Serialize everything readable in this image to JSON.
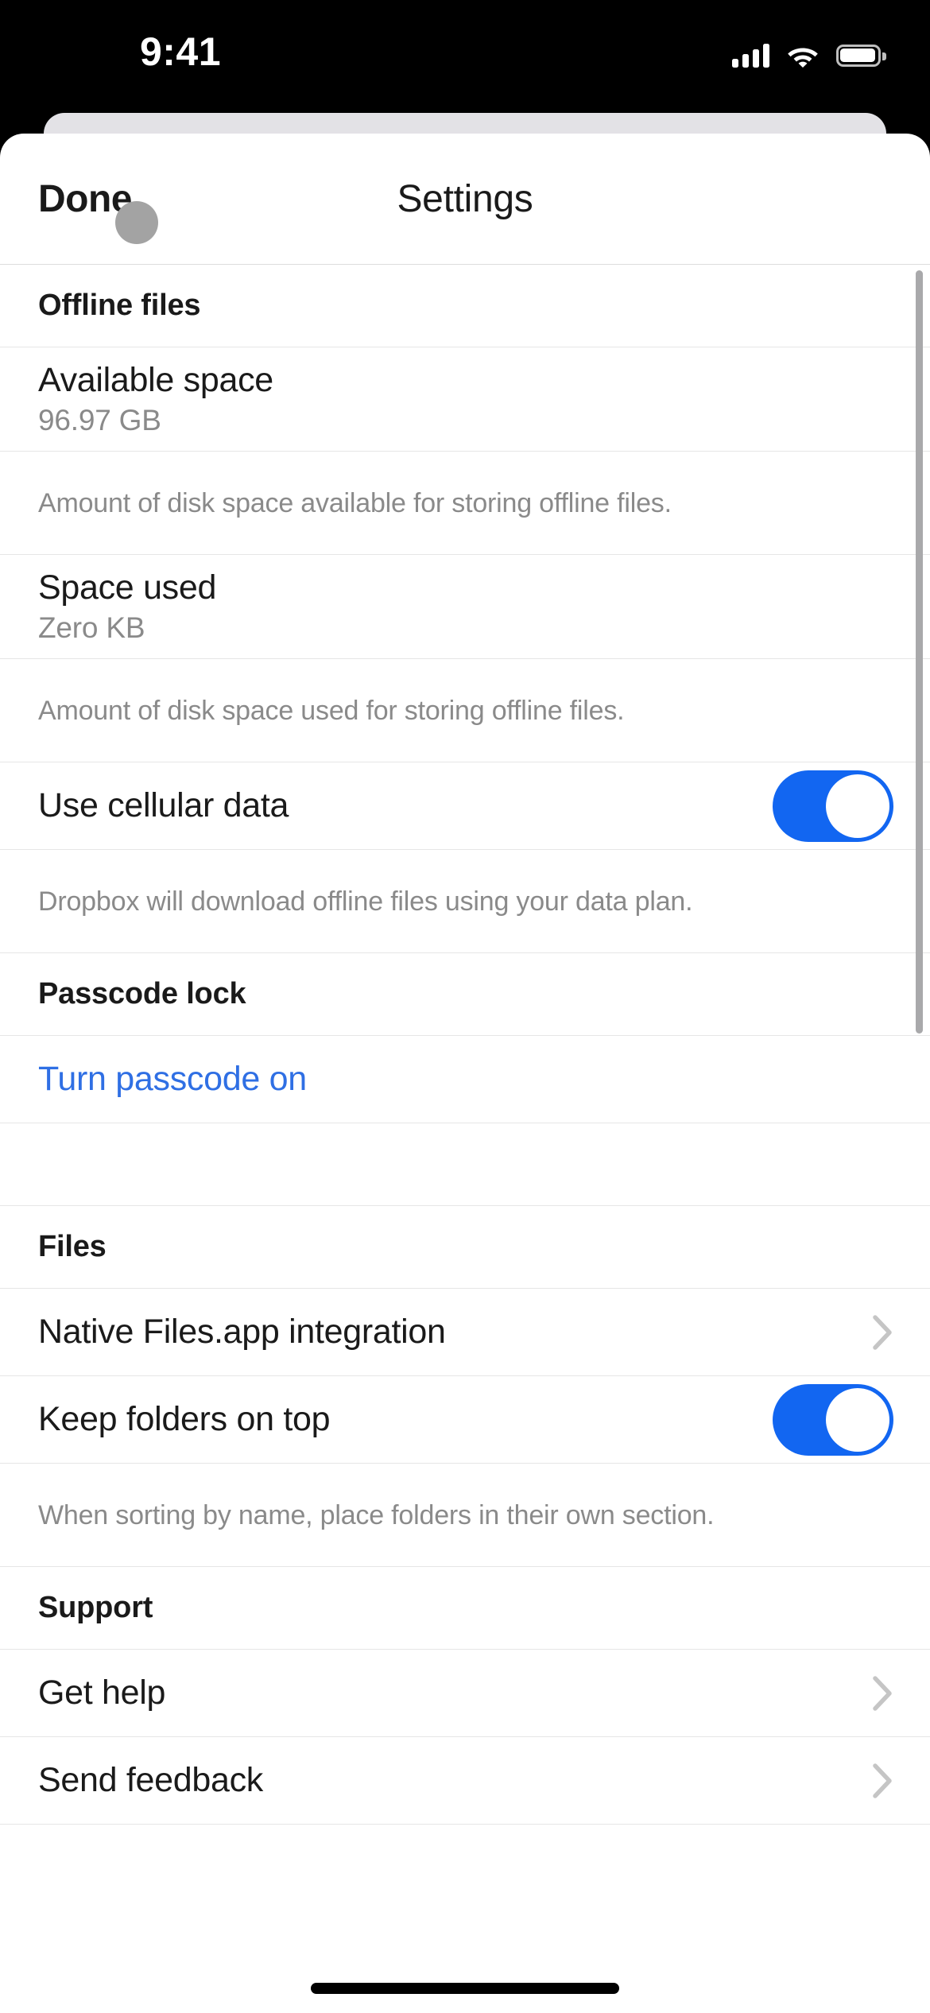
{
  "status_bar": {
    "time": "9:41",
    "icons": [
      "cellular-signal-icon",
      "wifi-icon",
      "battery-icon"
    ],
    "battery_level": 100,
    "cellular_bars": 4
  },
  "nav_bar": {
    "done_label": "Done",
    "title": "Settings"
  },
  "colors": {
    "accent_blue": "#1266f1",
    "link_blue": "#2f6fe4",
    "separator": "#e6e6e6",
    "secondary_text": "#8a8a8a",
    "primary_text": "#1a1a1a",
    "sheet_back": "#e3e2e6",
    "scrollbar": "#a9a9ab",
    "cursor": "#a3a3a3"
  },
  "sections": {
    "offline_files": {
      "header": "Offline files",
      "available_space": {
        "title": "Available space",
        "value": "96.97 GB",
        "description": "Amount of disk space available for storing offline files."
      },
      "space_used": {
        "title": "Space used",
        "value": "Zero KB",
        "description": "Amount of disk space used for storing offline files."
      },
      "use_cellular_data": {
        "title": "Use cellular data",
        "toggle_state": "on",
        "description": "Dropbox will download offline files using your data plan."
      }
    },
    "passcode_lock": {
      "header": "Passcode lock",
      "turn_passcode_on": "Turn passcode on"
    },
    "files": {
      "header": "Files",
      "native_files_integration": {
        "title": "Native Files.app integration",
        "accessory": "chevron-right-icon"
      },
      "keep_folders_on_top": {
        "title": "Keep folders on top",
        "toggle_state": "on",
        "description": "When sorting by name, place folders in their own section."
      }
    },
    "support": {
      "header": "Support",
      "get_help": {
        "title": "Get help",
        "accessory": "chevron-right-icon"
      },
      "send_feedback": {
        "title": "Send feedback",
        "accessory": "chevron-right-icon"
      }
    }
  }
}
